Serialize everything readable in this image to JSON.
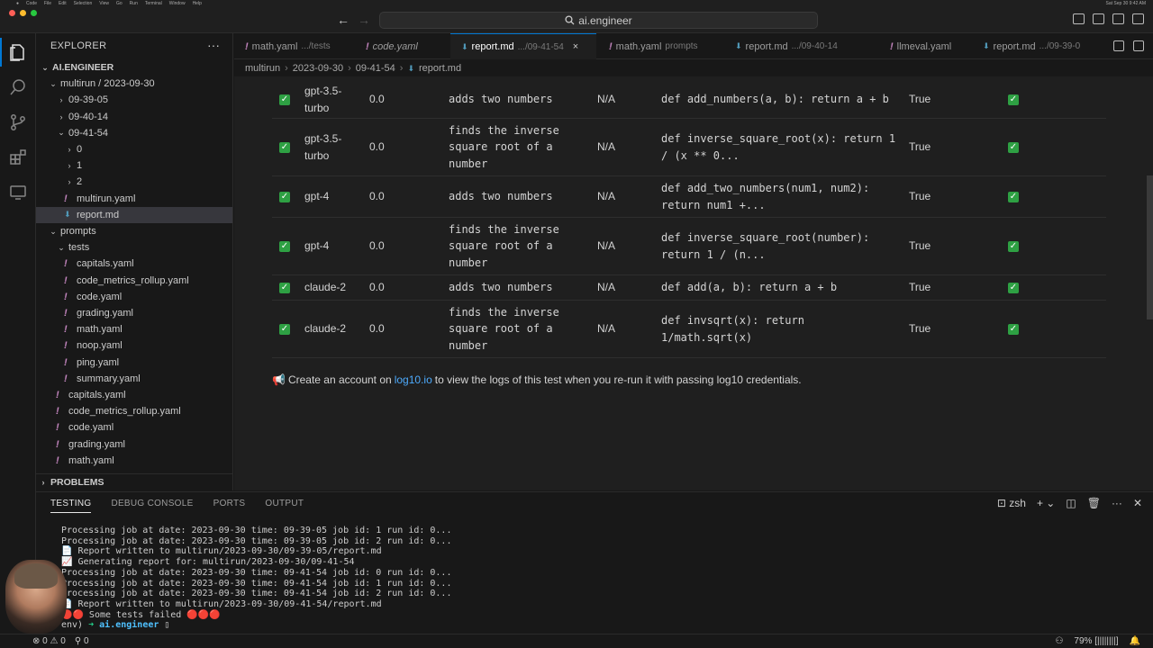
{
  "menubar": {
    "app": "Code",
    "items": [
      "File",
      "Edit",
      "Selection",
      "View",
      "Go",
      "Run",
      "Terminal",
      "Window",
      "Help"
    ],
    "clock": "Sat Sep 30 9:42 AM"
  },
  "titlebar": {
    "command_center": "ai.engineer"
  },
  "sidebar": {
    "title": "EXPLORER",
    "more": "···",
    "tree": [
      {
        "label": "AI.ENGINEER",
        "depth": 0,
        "kind": "section",
        "chev": "v"
      },
      {
        "label": "multirun / 2023-09-30",
        "depth": 1,
        "kind": "folder",
        "chev": "v"
      },
      {
        "label": "09-39-05",
        "depth": 2,
        "kind": "folder",
        "chev": ">"
      },
      {
        "label": "09-40-14",
        "depth": 2,
        "kind": "folder",
        "chev": ">"
      },
      {
        "label": "09-41-54",
        "depth": 2,
        "kind": "folder",
        "chev": "v"
      },
      {
        "label": "0",
        "depth": 3,
        "kind": "folder",
        "chev": ">"
      },
      {
        "label": "1",
        "depth": 3,
        "kind": "folder",
        "chev": ">"
      },
      {
        "label": "2",
        "depth": 3,
        "kind": "folder",
        "chev": ">"
      },
      {
        "label": "multirun.yaml",
        "depth": 3,
        "kind": "yaml"
      },
      {
        "label": "report.md",
        "depth": 3,
        "kind": "md",
        "selected": true
      },
      {
        "label": "prompts",
        "depth": 1,
        "kind": "folder",
        "chev": "v"
      },
      {
        "label": "tests",
        "depth": 2,
        "kind": "folder",
        "chev": "v"
      },
      {
        "label": "capitals.yaml",
        "depth": 3,
        "kind": "yaml"
      },
      {
        "label": "code_metrics_rollup.yaml",
        "depth": 3,
        "kind": "yaml"
      },
      {
        "label": "code.yaml",
        "depth": 3,
        "kind": "yaml"
      },
      {
        "label": "grading.yaml",
        "depth": 3,
        "kind": "yaml"
      },
      {
        "label": "math.yaml",
        "depth": 3,
        "kind": "yaml"
      },
      {
        "label": "noop.yaml",
        "depth": 3,
        "kind": "yaml"
      },
      {
        "label": "ping.yaml",
        "depth": 3,
        "kind": "yaml"
      },
      {
        "label": "summary.yaml",
        "depth": 3,
        "kind": "yaml"
      },
      {
        "label": "capitals.yaml",
        "depth": 2,
        "kind": "yaml"
      },
      {
        "label": "code_metrics_rollup.yaml",
        "depth": 2,
        "kind": "yaml"
      },
      {
        "label": "code.yaml",
        "depth": 2,
        "kind": "yaml"
      },
      {
        "label": "grading.yaml",
        "depth": 2,
        "kind": "yaml"
      },
      {
        "label": "math.yaml",
        "depth": 2,
        "kind": "yaml"
      }
    ],
    "problems": "PROBLEMS"
  },
  "tabs": [
    {
      "label": "math.yaml",
      "desc": ".../tests",
      "icon": "yaml",
      "italic": false
    },
    {
      "label": "code.yaml",
      "desc": "",
      "icon": "yaml",
      "italic": true
    },
    {
      "label": "report.md",
      "desc": ".../09-41-54",
      "icon": "md",
      "active": true,
      "close": "×"
    },
    {
      "label": "math.yaml",
      "desc": "prompts",
      "icon": "yaml",
      "italic": false
    },
    {
      "label": "report.md",
      "desc": ".../09-40-14",
      "icon": "md",
      "italic": false
    },
    {
      "label": "llmeval.yaml",
      "desc": "",
      "icon": "yaml",
      "italic": false
    },
    {
      "label": "report.md",
      "desc": ".../09-39-0",
      "icon": "md",
      "italic": false
    }
  ],
  "breadcrumb": [
    "multirun",
    "2023-09-30",
    "09-41-54",
    "report.md"
  ],
  "report": {
    "rows": [
      {
        "model": "gpt-3.5-turbo",
        "model_lines": [
          "gpt-3.5-",
          "turbo"
        ],
        "score": "0.0",
        "desc_lines": [
          "adds two numbers"
        ],
        "na": "N/A",
        "code_lines": [
          "def add_numbers(a, b): return a + b"
        ],
        "result": "True"
      },
      {
        "model": "gpt-3.5-turbo",
        "model_lines": [
          "gpt-3.5-",
          "turbo"
        ],
        "score": "0.0",
        "desc_lines": [
          "finds the inverse",
          "square root of a",
          "number"
        ],
        "na": "N/A",
        "code_lines": [
          "def inverse_square_root(x): return 1",
          "/ (x ** 0..."
        ],
        "result": "True"
      },
      {
        "model": "gpt-4",
        "model_lines": [
          "gpt-4"
        ],
        "score": "0.0",
        "desc_lines": [
          "adds two numbers"
        ],
        "na": "N/A",
        "code_lines": [
          "def add_two_numbers(num1, num2):",
          "return num1 +..."
        ],
        "result": "True"
      },
      {
        "model": "gpt-4",
        "model_lines": [
          "gpt-4"
        ],
        "score": "0.0",
        "desc_lines": [
          "finds the inverse",
          "square root of a",
          "number"
        ],
        "na": "N/A",
        "code_lines": [
          "def inverse_square_root(number):",
          "return 1 / (n..."
        ],
        "result": "True"
      },
      {
        "model": "claude-2",
        "model_lines": [
          "claude-2"
        ],
        "score": "0.0",
        "desc_lines": [
          "adds two numbers"
        ],
        "na": "N/A",
        "code_lines": [
          "def add(a, b): return a + b"
        ],
        "result": "True"
      },
      {
        "model": "claude-2",
        "model_lines": [
          "claude-2"
        ],
        "score": "0.0",
        "desc_lines": [
          "finds the inverse",
          "square root of a",
          "number"
        ],
        "na": "N/A",
        "code_lines": [
          "def invsqrt(x): return",
          "1/math.sqrt(x)"
        ],
        "result": "True"
      }
    ],
    "note_pre": "Create an account on",
    "note_link": "log10.io",
    "note_post": "to view the logs of this test when you re-run it with passing log10 credentials."
  },
  "panel": {
    "tabs": [
      "TESTING",
      "DEBUG CONSOLE",
      "PORTS",
      "OUTPUT"
    ],
    "active_tab": "TESTING",
    "shell": "zsh",
    "terminal_lines": [
      "Processing job at date: 2023-09-30 time: 09-39-05 job id: 1 run id: 0...",
      "Processing job at date: 2023-09-30 time: 09-39-05 job id: 2 run id: 0...",
      "📄 Report written to multirun/2023-09-30/09-39-05/report.md",
      "📈 Generating report for: multirun/2023-09-30/09-41-54",
      "Processing job at date: 2023-09-30 time: 09-41-54 job id: 0 run id: 0...",
      "Processing job at date: 2023-09-30 time: 09-41-54 job id: 1 run id: 0...",
      "Processing job at date: 2023-09-30 time: 09-41-54 job id: 2 run id: 0...",
      "📄 Report written to multirun/2023-09-30/09-41-54/report.md",
      "🔴🔴 Some tests failed 🔴🔴🔴"
    ],
    "prompt_prefix": "env) ",
    "prompt_arrow": "➜",
    "prompt_host": "ai.engineer",
    "cursor": "▯"
  },
  "statusbar": {
    "errors": "0",
    "warnings": "0",
    "ports": "0",
    "battery": "79% [||||||||]"
  },
  "colors": {
    "accent": "#0078d4",
    "check": "#2ea043",
    "link": "#4daafc",
    "yaml_icon": "#c586c0",
    "md_icon": "#519aba"
  }
}
